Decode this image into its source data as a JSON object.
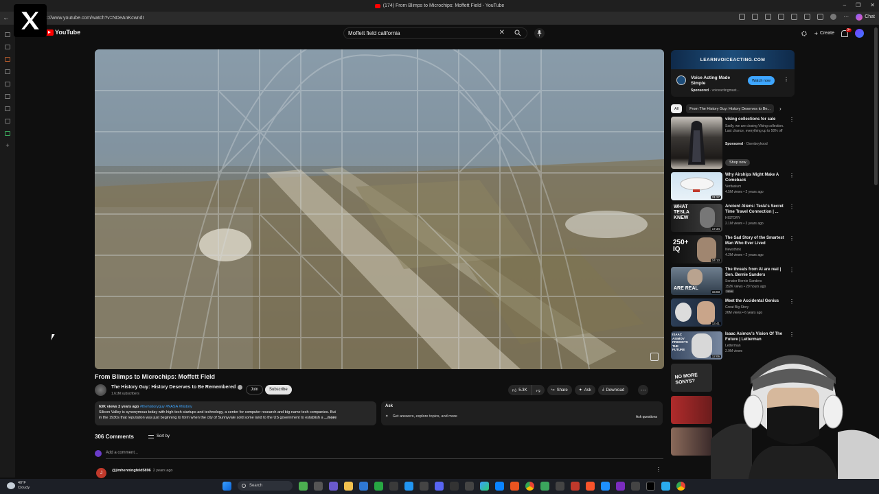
{
  "browser": {
    "tab_title": "(174) From Blimps to Microchips: Moffett Field - YouTube",
    "url": "c://www.youtube.com/watch?v=NDeAnKcwndI",
    "window_controls": [
      "–",
      "❐",
      "✕"
    ],
    "chat_label": "Chat"
  },
  "youtube": {
    "logo_text": "YouTube",
    "search_value": "Moffett field california",
    "create_label": "Create",
    "notification_count": "9+"
  },
  "video": {
    "title": "From Blimps to Microchips: Moffett Field",
    "channel": "The History Guy: History Deserves to Be Remembered",
    "subscribers": "1.61M subscribers",
    "join_label": "Join",
    "subscribe_label": "Subscribe",
    "likes": "5.3K",
    "share_label": "Share",
    "ask_label": "Ask",
    "download_label": "Download"
  },
  "description": {
    "meta": "63K views  2 years ago",
    "tags": "#thehistoryguy #NASA #history",
    "line1": "Silicon Valley is synonymous today with high-tech startups and technology, a center for computer research and big-name tech companies. But",
    "line2": "in the 1930s that reputation was just beginning to form when the city of Sunnyvale sold some land to the US government to establish a",
    "more": "...more"
  },
  "ask_panel": {
    "heading": "Ask",
    "prompt": "Get answers, explore topics, and more",
    "button": "Ask questions"
  },
  "comments": {
    "count_label": "306 Comments",
    "sort_label": "Sort by",
    "add_placeholder": "Add a comment...",
    "first": {
      "user": "@jimhenningfeld5896",
      "time": "2 years ago",
      "initial": "J"
    }
  },
  "ad": {
    "banner": "LEARNVOICEACTING.COM",
    "title": "Voice Acting Made Simple",
    "sponsored": "Sponsored",
    "domain": "voiceactingmast...",
    "cta": "Watch now"
  },
  "chips": [
    "All",
    "From The History Guy: History Deserves to Be..."
  ],
  "recommendations": [
    {
      "title": "viking collections for sale",
      "desc": "Sadly, we are closing Viking collection. Last chance, everything up to 50% off",
      "sponsored": "Sponsored",
      "channel": "Osenboyhood",
      "cta": "Shop now",
      "type": "ad"
    },
    {
      "title": "Why Airships Might Make A Comeback",
      "channel": "Veritasium",
      "views": "4.5M views • 2 years ago",
      "duration": "21:27"
    },
    {
      "title": "Ancient Aliens: Tesla's Secret Time Travel Connection | ...",
      "channel": "HISTORY",
      "views": "2.1M views • 2 years ago",
      "duration": "17:34",
      "thumb_text": "WHAT TESLA KNEW"
    },
    {
      "title": "The Sad Story of the Smartest Man Who Ever Lived",
      "channel": "Newsthink",
      "views": "4.2M views • 2 years ago",
      "duration": "14:13",
      "thumb_text": "250+ IQ"
    },
    {
      "title": "The threats from AI are real | Sen. Bernie Sanders",
      "channel": "Senator Bernie Sanders",
      "views": "152K views • 20 hours ago",
      "duration": "15:03",
      "badge": "New",
      "thumb_text": "ARE REAL"
    },
    {
      "title": "Meet the Accidental Genius",
      "channel": "Great Big Story",
      "views": "26M views • 6 years ago",
      "duration": "13:41"
    },
    {
      "title": "Isaac Asimov's Vision Of The Future | Letterman",
      "channel": "Letterman",
      "views": "2.9M views",
      "duration": "12:06",
      "thumb_text": "ISAAC ASIMOV PREDICTS THE FUTURE"
    }
  ],
  "partial_thumbs": [
    "NO MORE SONYS?"
  ],
  "taskbar": {
    "temp": "40°F",
    "condition": "Cloudy",
    "search": "Search"
  },
  "colors": {
    "accent_red": "#ff0000",
    "link_blue": "#3ea6ff",
    "background": "#0f0f0f"
  }
}
